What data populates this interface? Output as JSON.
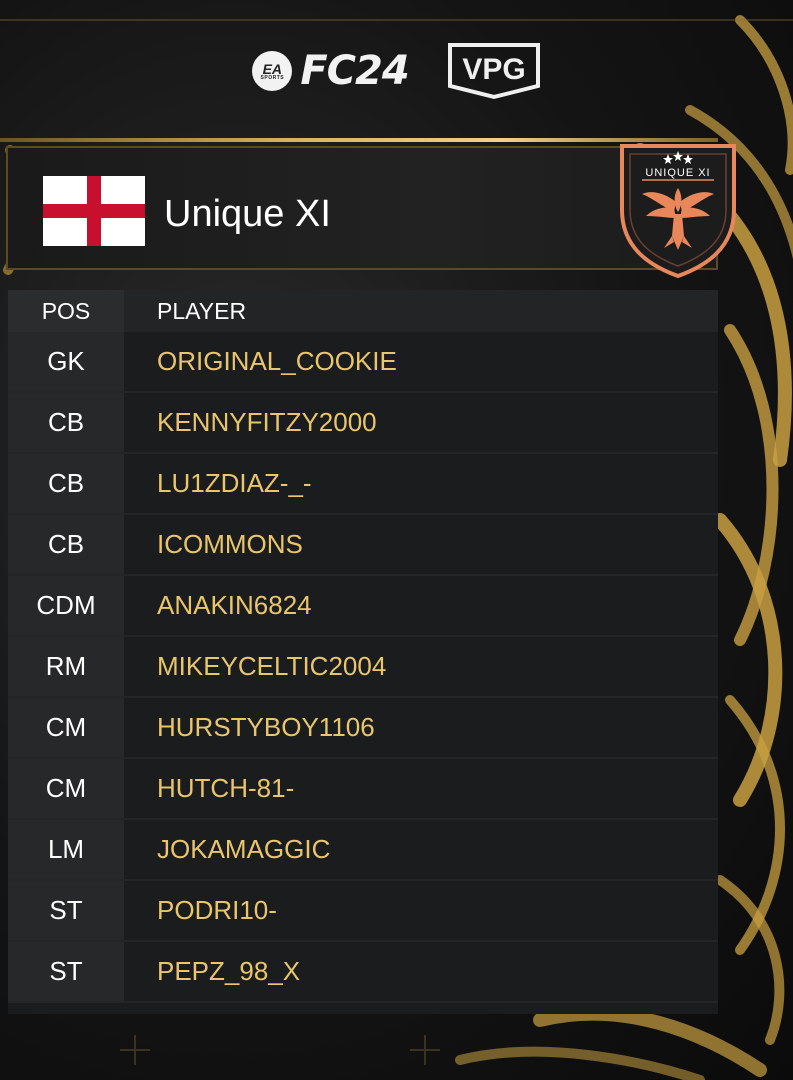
{
  "brand": {
    "ea_text": "EA",
    "ea_sub": "SPORTS",
    "game_text": "FC24",
    "vpg_text": "VPG"
  },
  "team": {
    "name": "Unique XI",
    "flag": "england-flag",
    "crest_text": "UNIQUE XI",
    "colors": {
      "accent": "#e9c56c",
      "gold_line": "#d8b35a",
      "flag_red": "#c8102e",
      "crest_orange": "#e8875a"
    }
  },
  "roster": {
    "headers": {
      "pos": "POS",
      "player": "PLAYER"
    },
    "rows": [
      {
        "pos": "GK",
        "player": "ORIGINAL_COOKIE"
      },
      {
        "pos": "CB",
        "player": "KENNYFITZY2000"
      },
      {
        "pos": "CB",
        "player": "LU1ZDIAZ-_-"
      },
      {
        "pos": "CB",
        "player": "ICOMMONS"
      },
      {
        "pos": "CDM",
        "player": "ANAKIN6824"
      },
      {
        "pos": "RM",
        "player": "MIKEYCELTIC2004"
      },
      {
        "pos": "CM",
        "player": "HURSTYBOY1106"
      },
      {
        "pos": "CM",
        "player": "HUTCH-81-"
      },
      {
        "pos": "LM",
        "player": "JOKAMAGGIC"
      },
      {
        "pos": "ST",
        "player": "PODRI10-"
      },
      {
        "pos": "ST",
        "player": "PEPZ_98_X"
      }
    ]
  }
}
